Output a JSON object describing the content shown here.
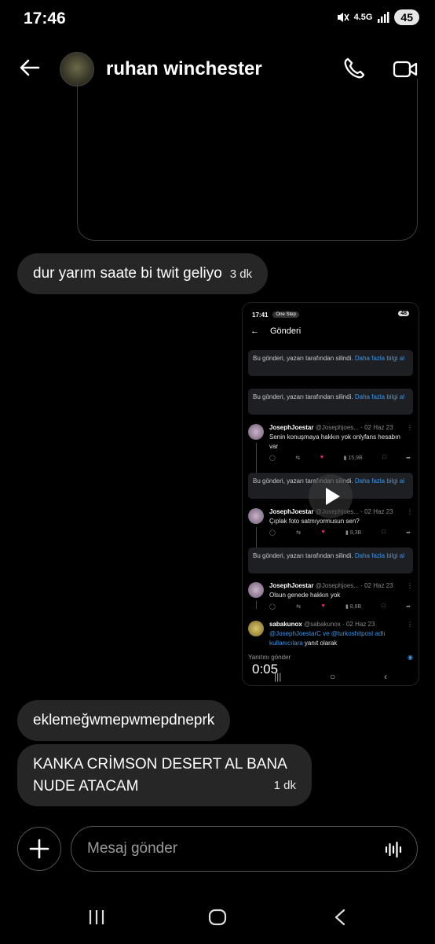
{
  "status_bar": {
    "time": "17:46",
    "network": "4.5G",
    "battery": "45"
  },
  "header": {
    "contact_name": "ruhan winchester"
  },
  "messages": [
    {
      "text": "dur yarım saate bi twit geliyo",
      "time": "3 dk"
    },
    {
      "text": "eklemeğwmepwmepdneprk"
    },
    {
      "text_line1": "KANKA CRİMSON DESERT AL BANA",
      "text_line2": "NUDE ATACAM",
      "time": "1 dk"
    }
  ],
  "video_message": {
    "status_time": "17:41",
    "status_app": "One Step",
    "battery": "48",
    "header_title": "Gönderi",
    "deleted_text": "Bu gönderi, yazarı tarafından silindi.",
    "deleted_link": "Daha fazla bilgi al",
    "tweets": [
      {
        "name": "JosephJoestar",
        "handle": "@Josephjoes...",
        "date": "· 02 Haz 23",
        "body": "Senin konuşmaya hakkın yok onlyfans hesabın var",
        "views": "15,9B"
      },
      {
        "name": "JosephJoestar",
        "handle": "@Josephjoes...",
        "date": "· 02 Haz 23",
        "body": "Çıplak foto satmıyormusun sen?",
        "views": "9,3B"
      },
      {
        "name": "JosephJoestar",
        "handle": "@Josephjoes...",
        "date": "· 02 Haz 23",
        "body": "Olsun genede hakkın yok",
        "views": "8,8B"
      }
    ],
    "reply_tweet": {
      "name": "sabakunox",
      "handle": "@sabakunox",
      "date": "· 02 Haz 23",
      "mentions": "@JosephJoestarC ve @turkoshitpost adlı kullanıcılara",
      "reply_suffix": "yanıt olarak"
    },
    "reply_placeholder": "Yanıtını gönder",
    "duration": "0:05"
  },
  "composer": {
    "placeholder": "Mesaj gönder"
  },
  "colors": {
    "bubble": "#262626",
    "link": "#3d96e8",
    "like": "#f0297a",
    "background": "#000000"
  }
}
